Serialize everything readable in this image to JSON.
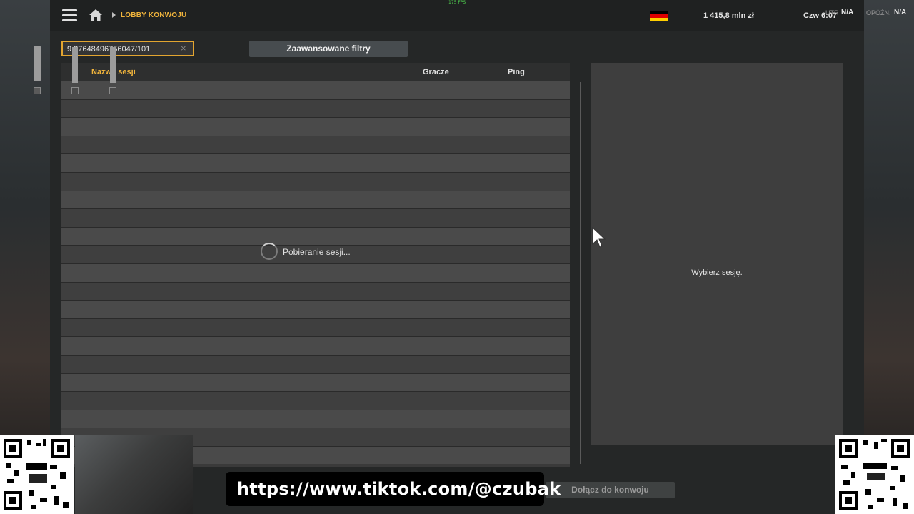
{
  "topbar": {
    "fps": "175 FPS",
    "breadcrumb": "LOBBY KONWOJU",
    "money": "1 415,8 mln  zł",
    "clock": "Czw 6:07",
    "net_label": "UTR",
    "net_value": "N/A",
    "delay_label": "OPÓŹN.",
    "delay_value": "N/A"
  },
  "search": {
    "value": "9 27648496756047/101"
  },
  "filters": {
    "advanced_label": "Zaawansowane filtry"
  },
  "table": {
    "columns": [
      "Nazwa sesji",
      "Gracze",
      "Ping"
    ],
    "loading_text": "Pobieranie sesji..."
  },
  "detail": {
    "placeholder": "Wybierz sesję."
  },
  "actions": {
    "join_label": "Dołącz do konwoju"
  },
  "overlay": {
    "banner_text": "https://www.tiktok.com/@czubak"
  },
  "colors": {
    "accent": "#f0b43c",
    "fps": "#4fd04f"
  }
}
